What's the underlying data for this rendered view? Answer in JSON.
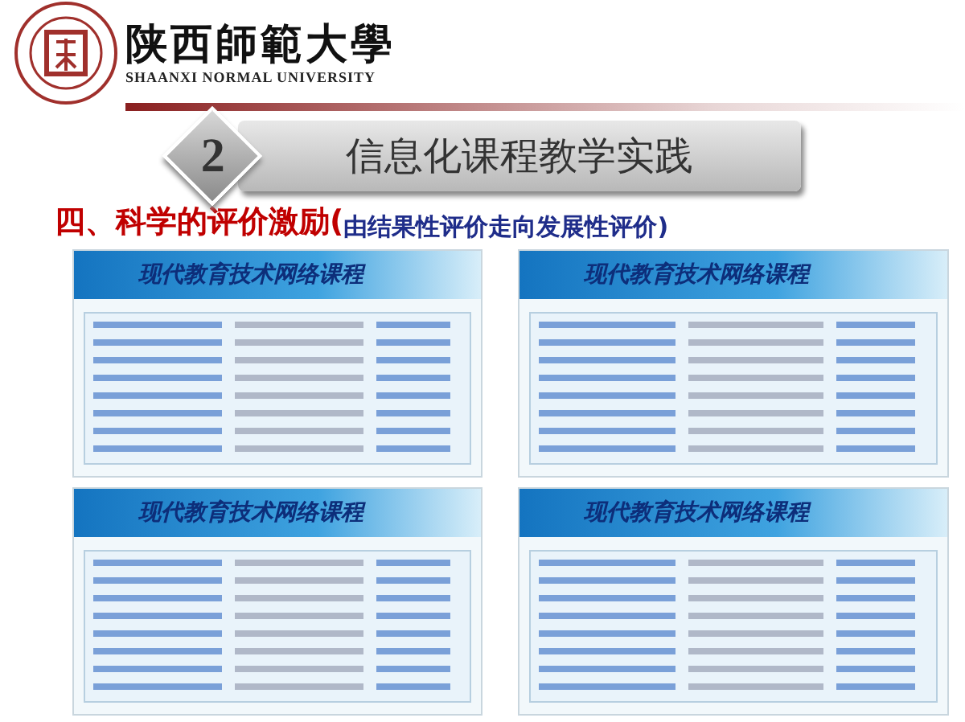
{
  "header": {
    "logo_text": "陕西師範大學",
    "logo_subtitle": "SHAANXI NORMAL UNIVERSITY"
  },
  "section": {
    "number": "2",
    "title": "信息化课程教学实践"
  },
  "heading": {
    "main": "四、科学的评价激励(",
    "sub": "由结果性评价走向发展性评价)"
  },
  "screenshots": [
    {
      "banner_title": "现代教育技术网络课程"
    },
    {
      "banner_title": "现代教育技术网络课程"
    },
    {
      "banner_title": "现代教育技术网络课程"
    },
    {
      "banner_title": "现代教育技术网络课程"
    }
  ]
}
